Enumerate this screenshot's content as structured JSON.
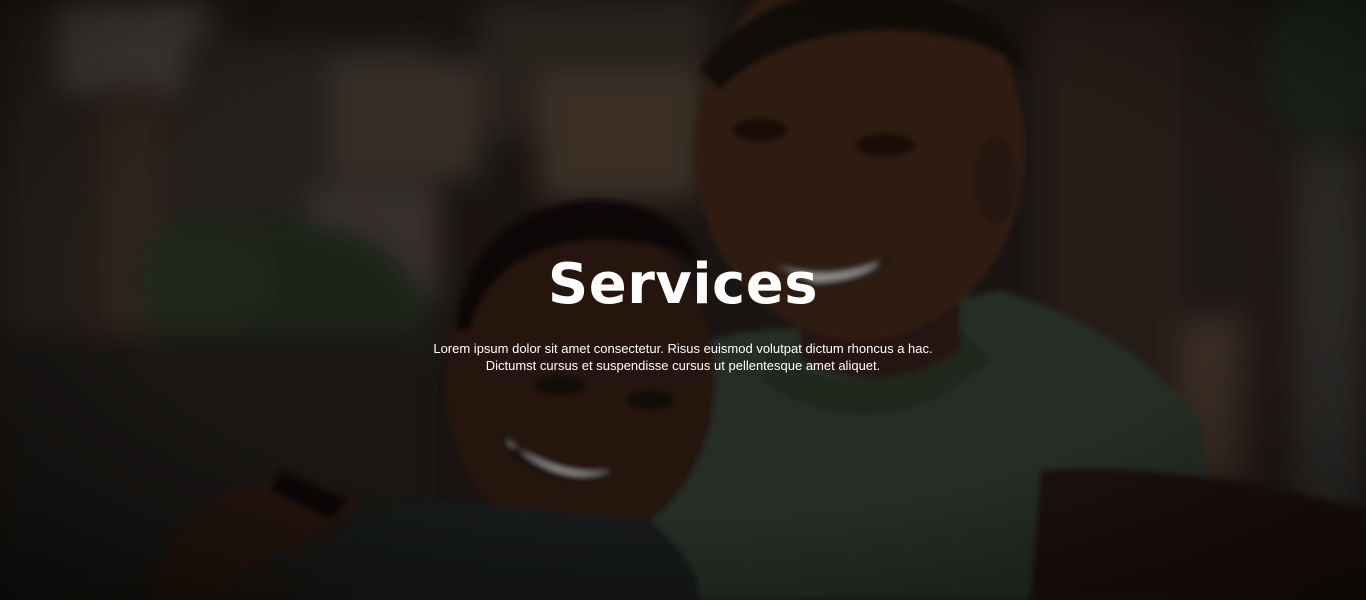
{
  "hero": {
    "title": "Services",
    "description": "Lorem ipsum dolor sit amet consectetur. Risus euismod volutpat dictum rhoncus a hac. Dictumst cursus et suspendisse cursus ut pellentesque amet aliquet.",
    "background_image": "smiling-couple-selfie-photo",
    "overlay_color": "#000000"
  }
}
